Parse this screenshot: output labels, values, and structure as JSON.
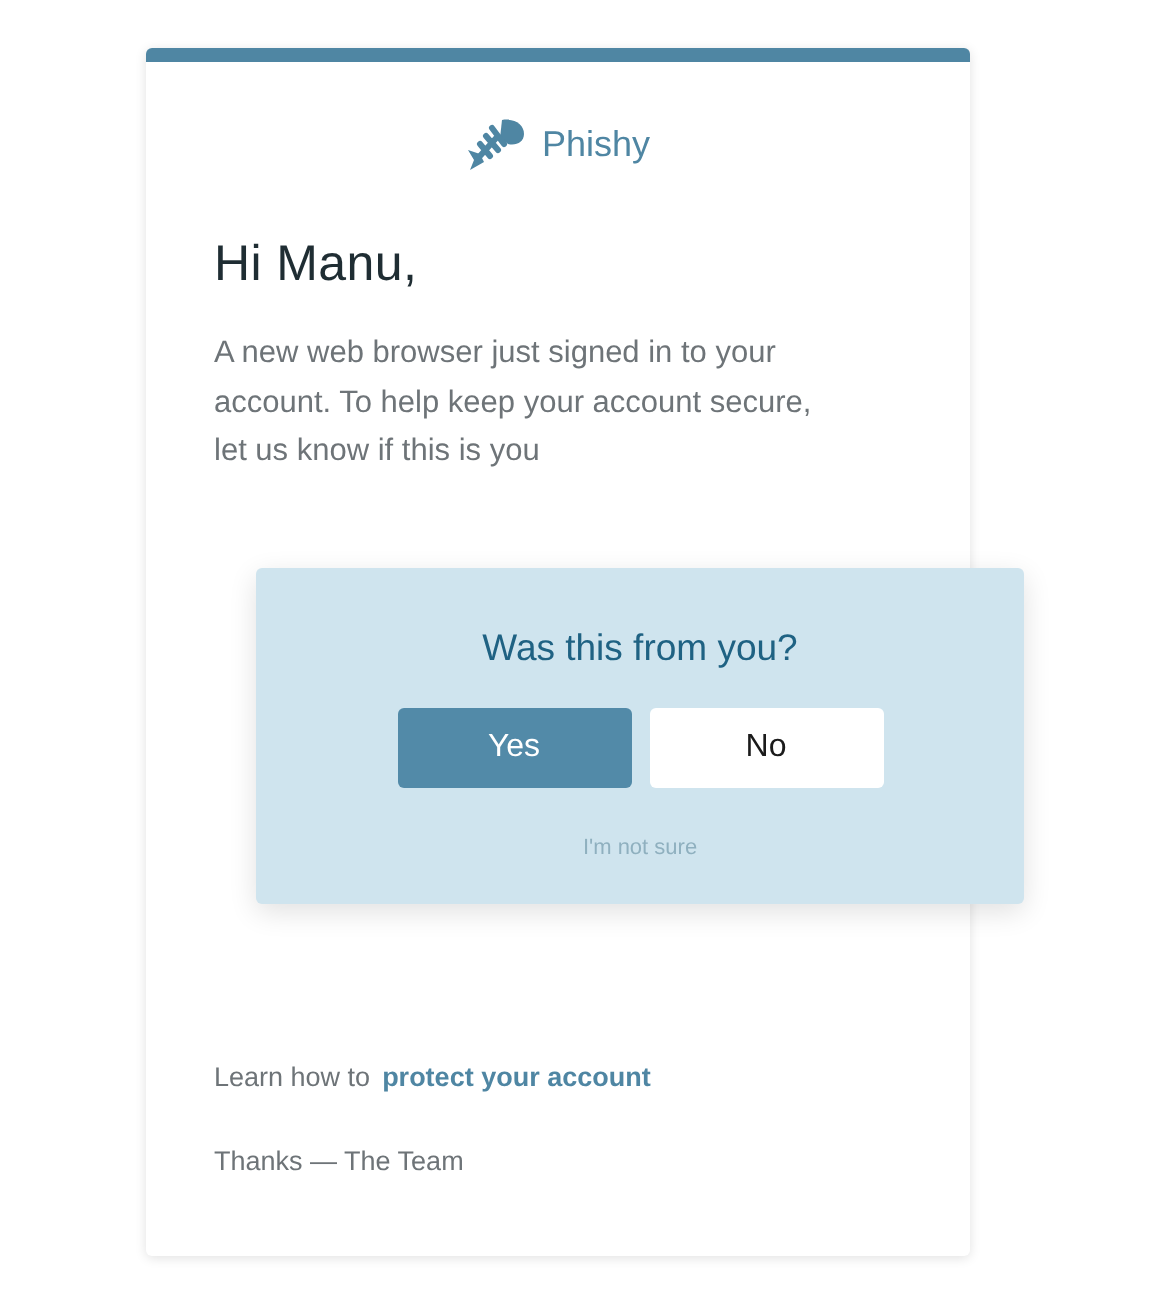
{
  "brand": {
    "name": "Phishy"
  },
  "greeting": "Hi Manu,",
  "message": "A new web browser just signed in to your account. To help keep your account secure, let us know if this is you",
  "prompt": {
    "title": "Was this from you?",
    "buttons": [
      {
        "label": "Yes",
        "kind": "primary"
      },
      {
        "label": "No",
        "kind": "secondary"
      }
    ],
    "link": "I'm not sure"
  },
  "footer": {
    "text": "Learn how to",
    "link": "protect your account",
    "signoff": "Thanks — The Team"
  }
}
